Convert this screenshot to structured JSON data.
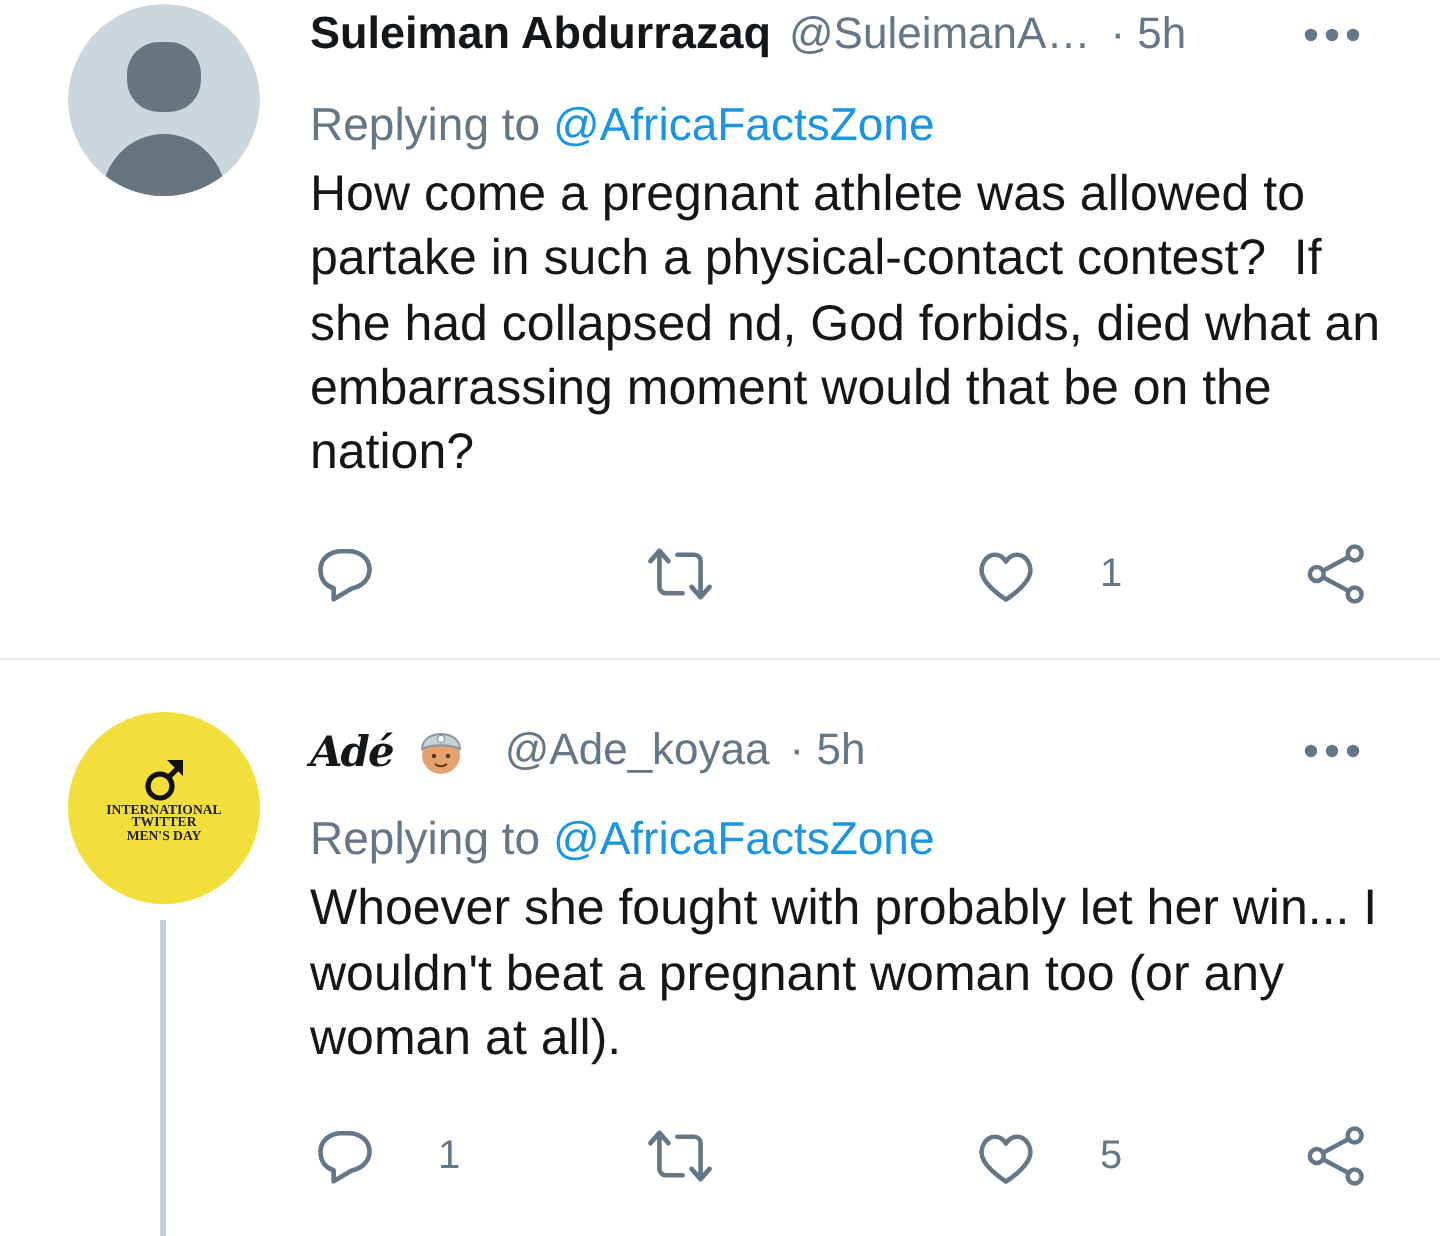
{
  "tweets": [
    {
      "avatar": {
        "kind": "default"
      },
      "name": "Suleiman Abdurrazaq",
      "name_script": false,
      "name_emoji": false,
      "handle": "@SuleimanA…",
      "time": "· 5h",
      "thread_line": false,
      "replying_label": "Replying to",
      "replying_to": "@AfricaFactsZone",
      "text": "How come a pregnant athlete was allowed to partake in such a physical-contact contest?  If she had collapsed nd, God forbids, died what an embarrassing moment would that be on the nation?",
      "actions": [
        {
          "kind": "reply"
        },
        {
          "kind": "retweet"
        },
        {
          "kind": "like",
          "count": "1"
        },
        {
          "kind": "share"
        }
      ]
    },
    {
      "avatar": {
        "kind": "image",
        "lines": [
          "INTERNATIONAL",
          "TWITTER",
          "MEN'S DAY"
        ]
      },
      "name": "Adé",
      "name_script": true,
      "name_emoji": true,
      "handle": "@Ade_koyaa",
      "time": "· 5h",
      "thread_line": true,
      "replying_label": "Replying to",
      "replying_to": "@AfricaFactsZone",
      "text": "Whoever she fought with probably let her win... I wouldn't beat a pregnant woman too (or any woman at all).",
      "actions": [
        {
          "kind": "reply",
          "count": "1"
        },
        {
          "kind": "retweet"
        },
        {
          "kind": "like",
          "count": "5"
        },
        {
          "kind": "share"
        }
      ]
    }
  ]
}
